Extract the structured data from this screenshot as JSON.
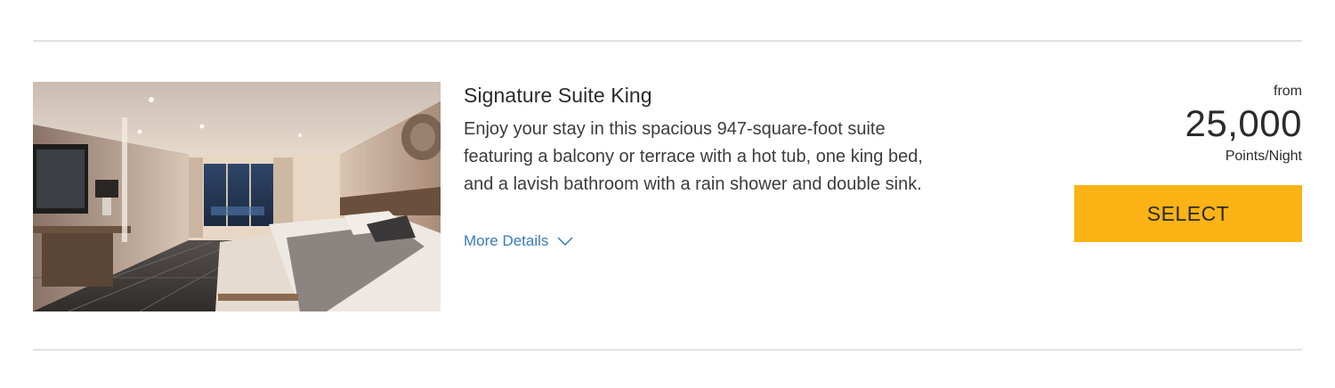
{
  "room": {
    "name": "Signature Suite King",
    "description": "Enjoy your stay in this spacious 947-square-foot suite featuring a balcony or terrace with a hot tub, one king bed, and a lavish bathroom with a rain shower and double sink.",
    "more_details_label": "More Details",
    "more_details_icon": "chevron-down-icon",
    "photo_alt": "Signature Suite King"
  },
  "price": {
    "from_label": "from",
    "points": "25,000",
    "unit_label": "Points/Night"
  },
  "actions": {
    "select_label": "SELECT"
  },
  "colors": {
    "accent_button": "#fbb315",
    "link": "#3a7bb8",
    "divider": "#e2e2e2"
  }
}
